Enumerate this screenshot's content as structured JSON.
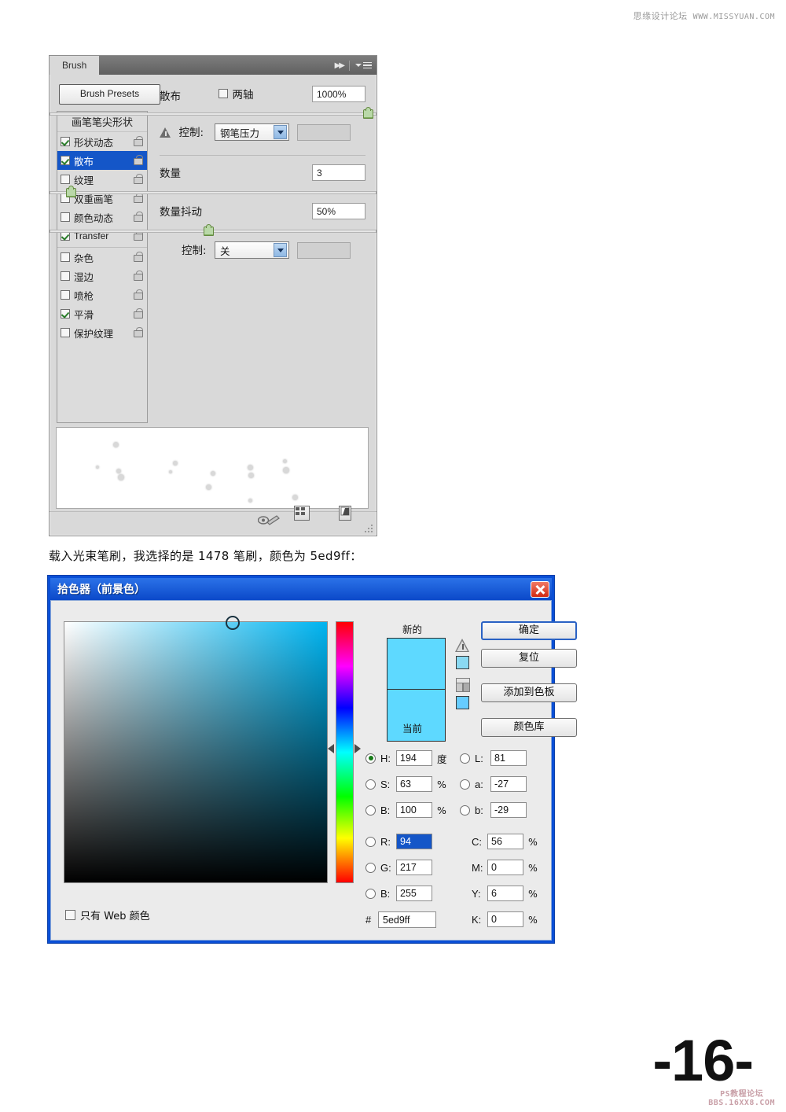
{
  "watermark": {
    "top_cn": "思缘设计论坛",
    "top_url": "WWW.MISSYUAN.COM",
    "bottom_line1": "PS教程论坛",
    "bottom_line2": "BBS.16XX8.COM"
  },
  "page_number": "-16-",
  "caption": "载入光束笔刷，我选择的是 1478 笔刷，颜色为 5ed9ff：",
  "brush_panel": {
    "tab_label": "Brush",
    "presets_button": "Brush Presets",
    "list_header": "画笔笔尖形状",
    "options": [
      {
        "label": "形状动态",
        "checked": true,
        "selected": false,
        "group_start": false,
        "latin": false
      },
      {
        "label": "散布",
        "checked": true,
        "selected": true,
        "group_start": false,
        "latin": false
      },
      {
        "label": "纹理",
        "checked": false,
        "selected": false,
        "group_start": false,
        "latin": false
      },
      {
        "label": "双重画笔",
        "checked": false,
        "selected": false,
        "group_start": false,
        "latin": false
      },
      {
        "label": "颜色动态",
        "checked": false,
        "selected": false,
        "group_start": false,
        "latin": false
      },
      {
        "label": "Transfer",
        "checked": true,
        "selected": false,
        "group_start": false,
        "latin": true
      },
      {
        "label": "杂色",
        "checked": false,
        "selected": false,
        "group_start": true,
        "latin": false
      },
      {
        "label": "湿边",
        "checked": false,
        "selected": false,
        "group_start": false,
        "latin": false
      },
      {
        "label": "喷枪",
        "checked": false,
        "selected": false,
        "group_start": false,
        "latin": false
      },
      {
        "label": "平滑",
        "checked": true,
        "selected": false,
        "group_start": false,
        "latin": false
      },
      {
        "label": "保护纹理",
        "checked": false,
        "selected": false,
        "group_start": false,
        "latin": false
      }
    ],
    "scatter": {
      "label": "散布",
      "both_axes_label": "两轴",
      "both_axes_checked": false,
      "value": "1000%",
      "slider_percent": 97
    },
    "control_1": {
      "label": "控制:",
      "value": "钢笔压力"
    },
    "count": {
      "label": "数量",
      "value": "3",
      "slider_percent": 6
    },
    "count_jitter": {
      "label": "数量抖动",
      "value": "50%",
      "slider_percent": 49
    },
    "control_2": {
      "label": "控制:",
      "value": "关"
    },
    "footer_icons": [
      "brush-toggle-icon",
      "preset-grid-icon",
      "new-brush-icon",
      "resize-grip-icon"
    ]
  },
  "color_picker": {
    "title": "拾色器（前景色）",
    "close_label": "×",
    "new_label": "新的",
    "current_label": "当前",
    "new_color": "#5ed9ff",
    "current_color": "#5ed9ff",
    "buttons": [
      {
        "label": "确定",
        "primary": true
      },
      {
        "label": "复位",
        "primary": false
      },
      {
        "label": "添加到色板",
        "primary": false
      },
      {
        "label": "颜色库",
        "primary": false
      }
    ],
    "hsb": [
      {
        "key": "H:",
        "value": "194",
        "unit": "度",
        "selected": true
      },
      {
        "key": "S:",
        "value": "63",
        "unit": "%",
        "selected": false
      },
      {
        "key": "B:",
        "value": "100",
        "unit": "%",
        "selected": false
      }
    ],
    "rgb": [
      {
        "key": "R:",
        "value": "94",
        "unit": "",
        "selected": false,
        "highlight": true
      },
      {
        "key": "G:",
        "value": "217",
        "unit": "",
        "selected": false,
        "highlight": false
      },
      {
        "key": "B:",
        "value": "255",
        "unit": "",
        "selected": false,
        "highlight": false
      }
    ],
    "lab": [
      {
        "key": "L:",
        "value": "81",
        "unit": ""
      },
      {
        "key": "a:",
        "value": "-27",
        "unit": ""
      },
      {
        "key": "b:",
        "value": "-29",
        "unit": ""
      }
    ],
    "cmyk": [
      {
        "key": "C:",
        "value": "56",
        "unit": "%"
      },
      {
        "key": "M:",
        "value": "0",
        "unit": "%"
      },
      {
        "key": "Y:",
        "value": "6",
        "unit": "%"
      },
      {
        "key": "K:",
        "value": "0",
        "unit": "%"
      }
    ],
    "hex_label": "#",
    "hex_value": "5ed9ff",
    "web_only_label": "只有 Web 颜色",
    "web_only_checked": false
  }
}
